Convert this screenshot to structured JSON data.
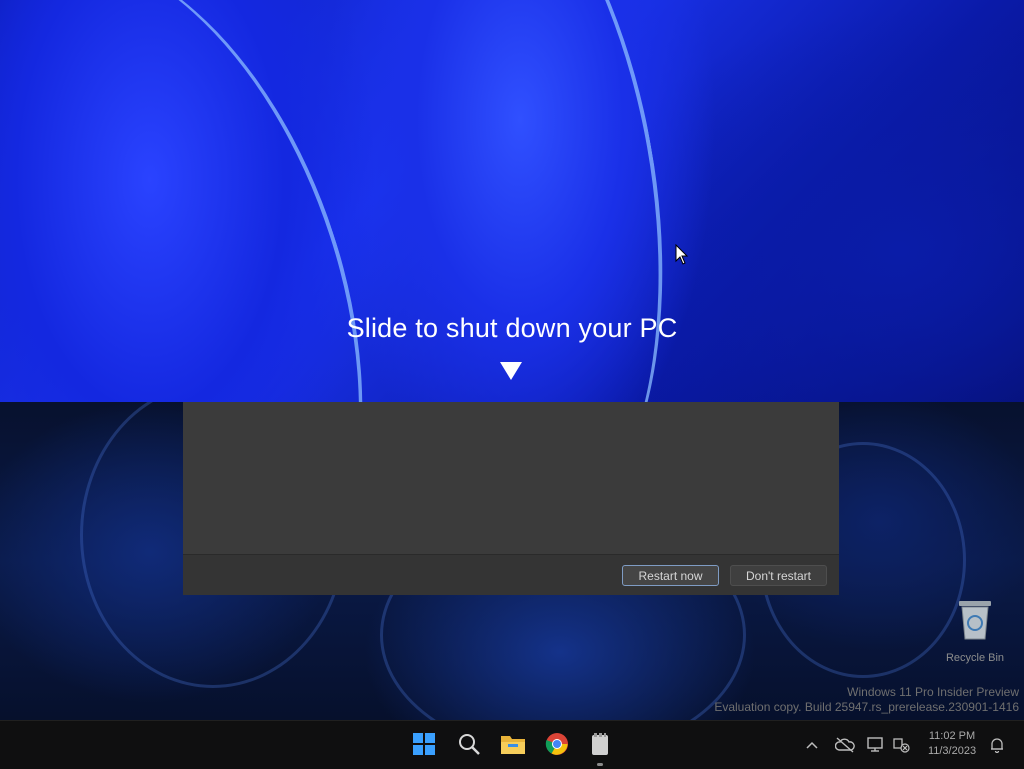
{
  "shutdown": {
    "title": "Slide to shut down your PC"
  },
  "dialog": {
    "restart_now_label": "Restart now",
    "dont_restart_label": "Don't restart"
  },
  "desktop": {
    "recycle_bin_label": "Recycle Bin",
    "watermark_line1": "Windows 11 Pro Insider Preview",
    "watermark_line2": "Evaluation copy. Build 25947.rs_prerelease.230901-1416"
  },
  "taskbar": {
    "pinned": [
      "start-icon",
      "search-icon",
      "file-explorer-icon",
      "chrome-icon",
      "notepad-icon"
    ],
    "time": "11:02 PM",
    "date": "11/3/2023",
    "tray_icons": [
      "chevron-up-icon",
      "onedrive-icon",
      "display-icon",
      "network-icon",
      "notification-bell-icon"
    ]
  },
  "colors": {
    "accent_blue": "#1b34f0",
    "taskbar_bg": "#0f0f10",
    "dialog_bg": "#3b3b3b"
  }
}
